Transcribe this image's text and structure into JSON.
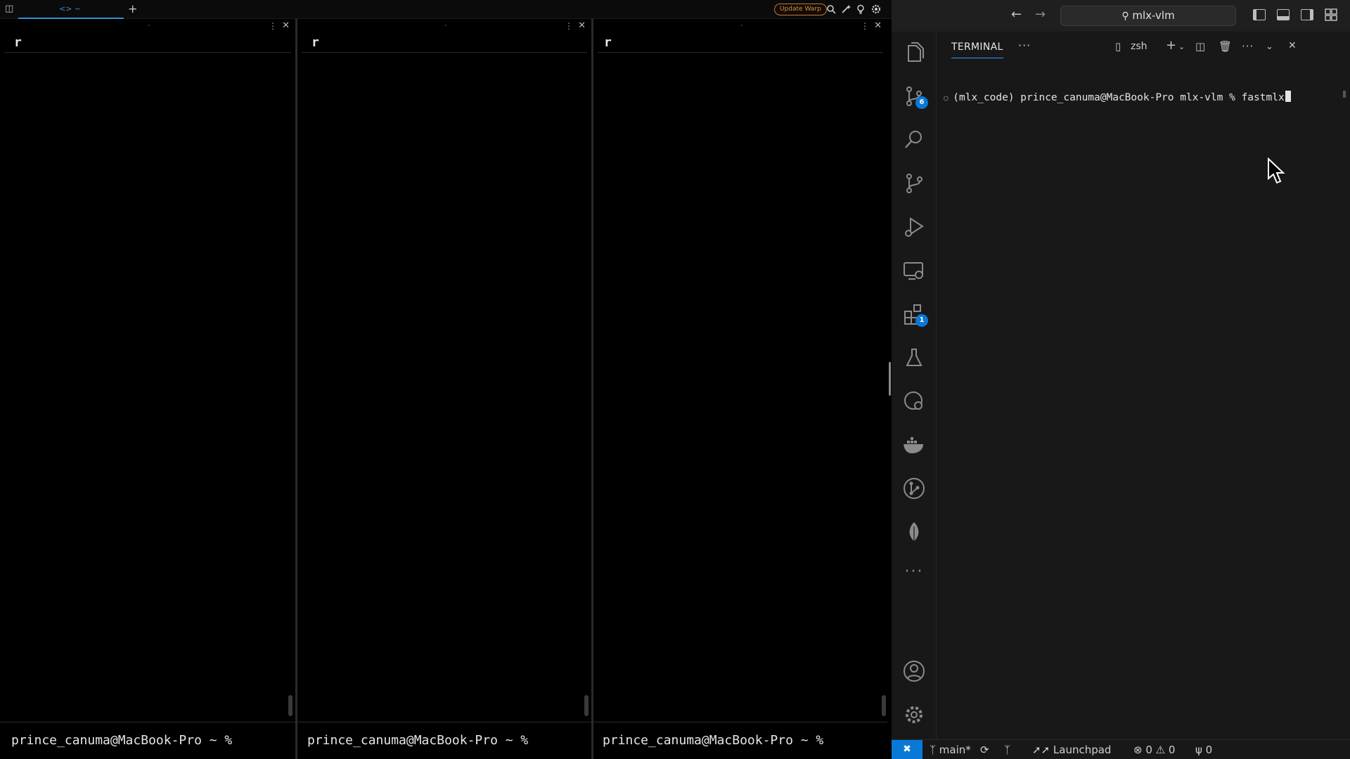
{
  "warp": {
    "tab_label": "<> ~",
    "new_tab": "+",
    "update_button": "Update Warp",
    "panes": [
      {
        "dash": "-",
        "block_command": "r",
        "prompt": "prince_canuma@MacBook-Pro ~ %"
      },
      {
        "dash": "-",
        "block_command": "r",
        "prompt": "prince_canuma@MacBook-Pro ~ %"
      },
      {
        "dash": "-",
        "block_command": "r",
        "prompt": "prince_canuma@MacBook-Pro ~ %"
      }
    ]
  },
  "vscode": {
    "search_title": "mlx-vlm",
    "activity": {
      "source_control_badge": "6",
      "extensions_badge": "1"
    },
    "panel": {
      "tab": "TERMINAL",
      "more": "···",
      "shell": "zsh",
      "line_prefix": "(mlx_code) prince_canuma@MacBook-Pro mlx-vlm % ",
      "line_input": "fastmlx"
    },
    "status": {
      "branch": "main*",
      "launchpad": "Launchpad",
      "errors": "0",
      "warnings": "0",
      "ports": "0"
    },
    "accent": "#0a78d7"
  }
}
